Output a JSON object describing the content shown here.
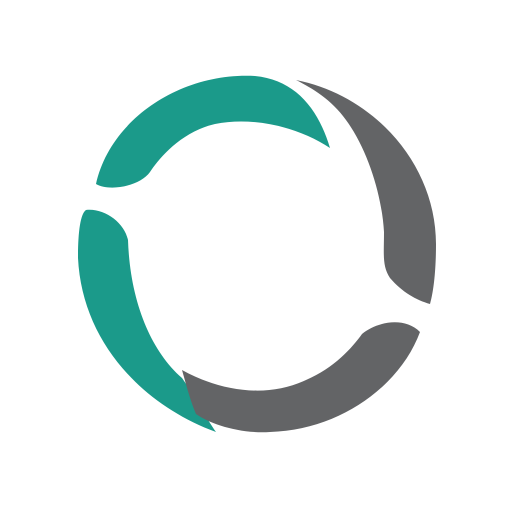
{
  "logo": {
    "icon": "circular-segmented-ring-logo",
    "colors": {
      "background": "#ffffff",
      "teal": "#1b9a8a",
      "gray": "#636466"
    },
    "segments": [
      {
        "name": "teal-top-left-arc",
        "color": "teal"
      },
      {
        "name": "teal-left-arc",
        "color": "teal"
      },
      {
        "name": "gray-right-arc",
        "color": "gray"
      },
      {
        "name": "gray-bottom-arc",
        "color": "gray"
      }
    ]
  }
}
